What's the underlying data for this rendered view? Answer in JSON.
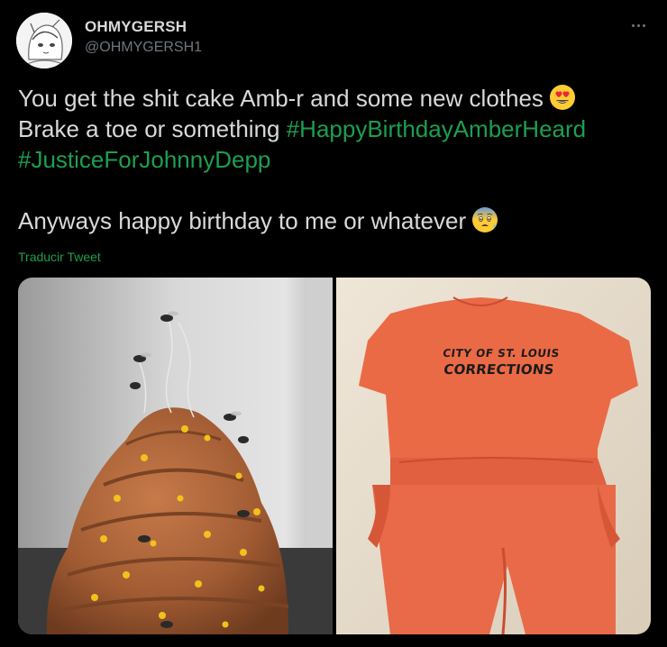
{
  "user": {
    "display_name": "OHMYGERSH",
    "handle": "@OHMYGERSH1"
  },
  "tweet": {
    "line1": "You get the shit cake Amb-r and some new clothes",
    "line1_emoji": "heart-eyes-emoji",
    "line2_text": "Brake a toe or something ",
    "hashtag1": "#HappyBirthdayAmberHeard",
    "hashtag2": "#JusticeForJohnnyDepp",
    "line4": "Anyways happy birthday to me or whatever",
    "line4_emoji": "anxious-face-emoji"
  },
  "translate_label": "Traducir Tweet",
  "media": {
    "photo2_text_line1": "CITY OF ST. LOUIS",
    "photo2_text_line2": "CORRECTIONS"
  },
  "colors": {
    "background": "#000000",
    "text": "#d9d9d9",
    "handle": "#6e767d",
    "hashtag": "#1d9f4f"
  }
}
